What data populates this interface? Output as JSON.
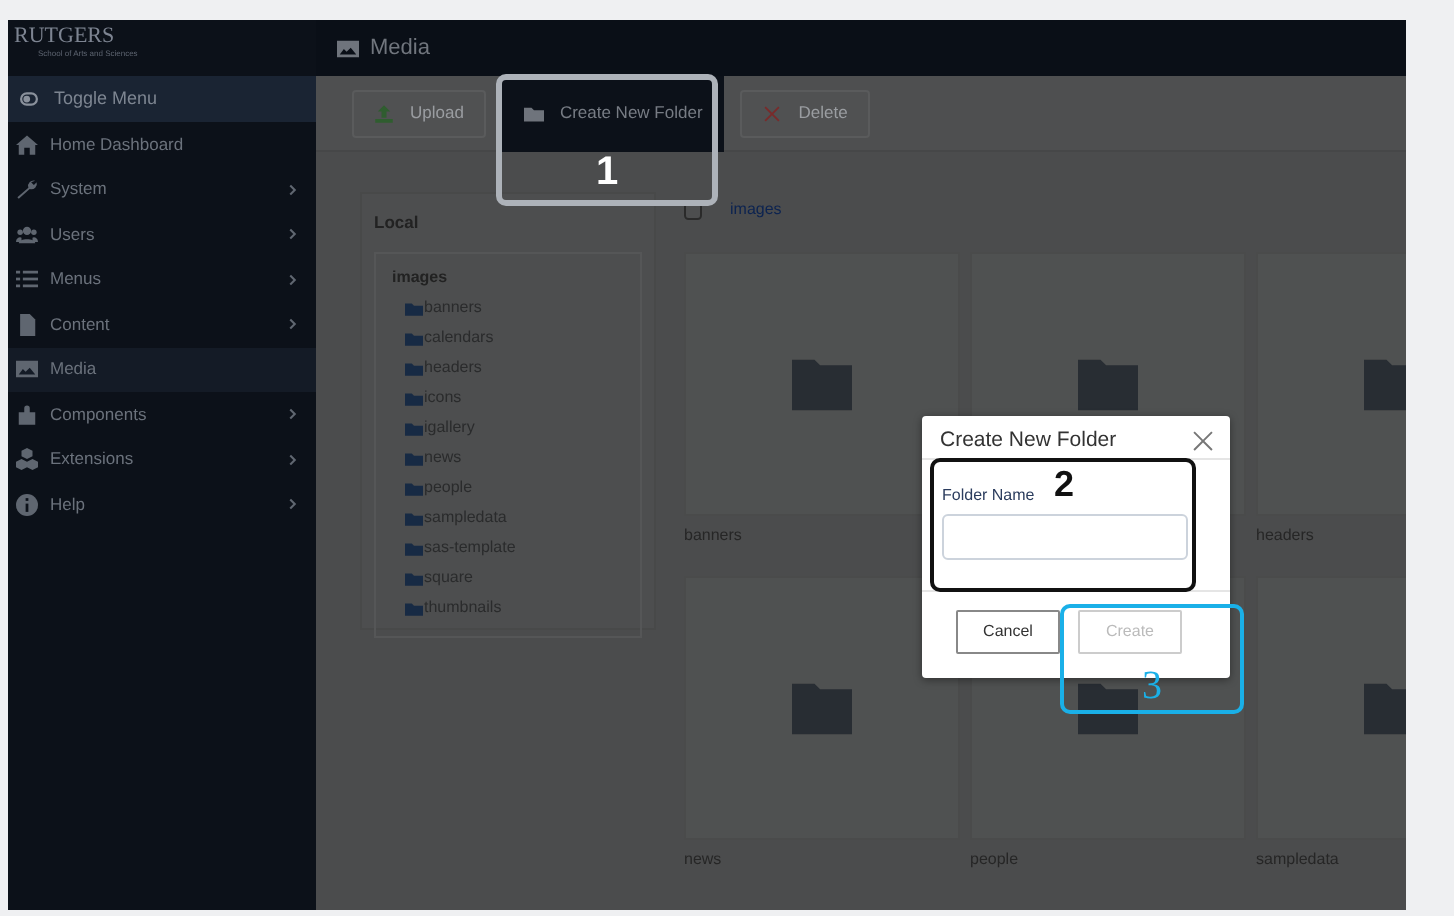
{
  "sidebar": {
    "logo": "RUTGERS",
    "logo_subtitle": "School of Arts and Sciences",
    "toggle": "Toggle Menu",
    "items": [
      {
        "label": "Home Dashboard",
        "submenu": false,
        "selected": false
      },
      {
        "label": "System",
        "submenu": true,
        "selected": false
      },
      {
        "label": "Users",
        "submenu": true,
        "selected": false
      },
      {
        "label": "Menus",
        "submenu": true,
        "selected": false
      },
      {
        "label": "Content",
        "submenu": true,
        "selected": false
      },
      {
        "label": "Media",
        "submenu": false,
        "selected": true
      },
      {
        "label": "Components",
        "submenu": true,
        "selected": false
      },
      {
        "label": "Extensions",
        "submenu": true,
        "selected": false
      },
      {
        "label": "Help",
        "submenu": true,
        "selected": false
      }
    ]
  },
  "header": {
    "title": "Media"
  },
  "toolbar": [
    {
      "label": "Upload",
      "highlighted": false
    },
    {
      "label": "Create New Folder",
      "highlighted": true
    },
    {
      "label": "Delete",
      "highlighted": false
    }
  ],
  "tree": {
    "title": "Local",
    "root": "images",
    "children": [
      {
        "label": "banners"
      },
      {
        "label": "calendars"
      },
      {
        "label": "headers"
      },
      {
        "label": "icons"
      },
      {
        "label": "igallery"
      },
      {
        "label": "news"
      },
      {
        "label": "people"
      },
      {
        "label": "sampledata"
      },
      {
        "label": "sas-template"
      },
      {
        "label": "square"
      },
      {
        "label": "thumbnails"
      }
    ]
  },
  "browser": {
    "breadcrumb": "images",
    "select_all": {
      "checked": false
    },
    "tiles": [
      {
        "kind": "folder",
        "label": "banners"
      },
      {
        "kind": "folder"
      },
      {
        "kind": "folder",
        "label": "headers"
      },
      {
        "kind": "folder",
        "label": "news"
      },
      {
        "kind": "folder",
        "label": "people"
      },
      {
        "kind": "folder",
        "label": "sampledata"
      }
    ]
  },
  "dialog": {
    "title": "Create New Folder",
    "field_label": "Folder Name",
    "buttons": [
      {
        "label": "Cancel",
        "disabled": false
      },
      {
        "label": "Create",
        "disabled": true
      }
    ]
  },
  "annotations": [
    {
      "label": "1",
      "kind": "grey"
    },
    {
      "label": "2",
      "kind": "black"
    },
    {
      "label": "3",
      "kind": "cyan"
    }
  ]
}
